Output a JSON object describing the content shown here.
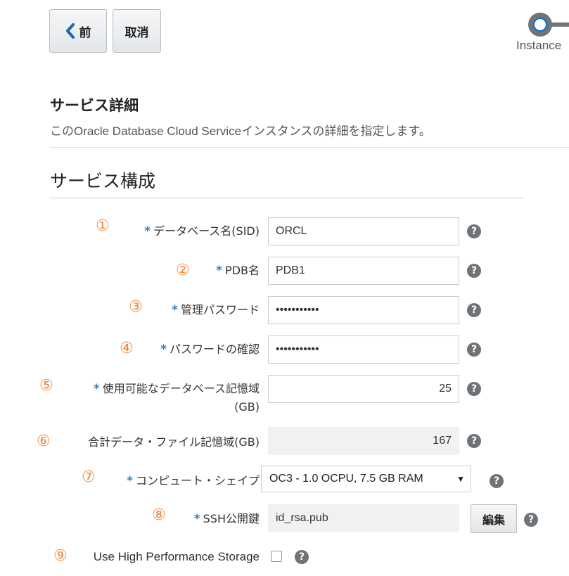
{
  "toolbar": {
    "back_label": "前",
    "cancel_label": "取消"
  },
  "train": {
    "current_stop_label": "Instance"
  },
  "section": {
    "title": "サービス詳細",
    "description": "このOracle Database Cloud Serviceインスタンスの詳細を指定します。"
  },
  "config": {
    "title": "サービス構成",
    "required_marker": "*",
    "help_symbol": "?",
    "fields": [
      {
        "number": "①",
        "label": "データベース名(SID)",
        "value": "ORCL"
      },
      {
        "number": "②",
        "label": "PDB名",
        "value": "PDB1"
      },
      {
        "number": "③",
        "label": "管理パスワード",
        "value": "•••••••••••"
      },
      {
        "number": "④",
        "label": "パスワードの確認",
        "value": "•••••••••••"
      },
      {
        "number": "⑤",
        "label_line1": "使用可能なデータベース記憶域",
        "label_line2": "(GB)",
        "value": "25"
      },
      {
        "number": "⑥",
        "label": "合計データ・ファイル記憶域(GB)",
        "value": "167"
      },
      {
        "number": "⑦",
        "label": "コンピュート・シェイプ",
        "value": "OC3 - 1.0 OCPU, 7.5 GB RAM",
        "dropdown_arrow": "▼"
      },
      {
        "number": "⑧",
        "label": "SSH公開鍵",
        "value": "id_rsa.pub",
        "button_label": "編集"
      },
      {
        "number": "⑨",
        "label": "Use High Performance Storage",
        "checked": false
      }
    ]
  },
  "colors": {
    "accent_number": "#f0883c",
    "required_star": "#2e7fbd",
    "focus_ring": "#0572ce"
  }
}
